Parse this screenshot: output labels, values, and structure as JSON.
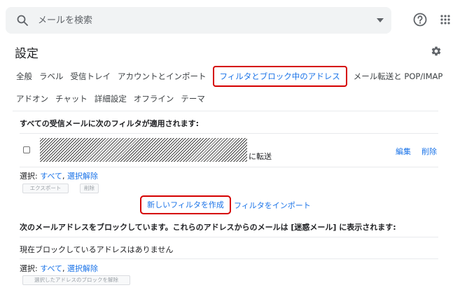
{
  "search": {
    "placeholder": "メールを検索"
  },
  "header": {
    "title": "設定"
  },
  "tabs_row1": [
    {
      "label": "全般"
    },
    {
      "label": "ラベル"
    },
    {
      "label": "受信トレイ"
    },
    {
      "label": "アカウントとインポート"
    },
    {
      "label": "フィルタとブロック中のアドレス",
      "active": true
    },
    {
      "label": "メール転送と POP/IMAP"
    }
  ],
  "tabs_row2": [
    {
      "label": "アドオン"
    },
    {
      "label": "チャット"
    },
    {
      "label": "詳細設定"
    },
    {
      "label": "オフライン"
    },
    {
      "label": "テーマ"
    }
  ],
  "filters": {
    "heading": "すべての受信メールに次のフィルタが適用されます:",
    "row": {
      "action": "に転送",
      "edit": "編集",
      "delete": "削除"
    },
    "select_label": "選択:",
    "select_all": "すべて",
    "select_none": "選択解除",
    "export": "エクスポート",
    "delete": "削除",
    "create": "新しいフィルタを作成",
    "import": "フィルタをインポート"
  },
  "blocked": {
    "heading": "次のメールアドレスをブロックしています。これらのアドレスからのメールは [迷惑メール] に表示されます:",
    "empty": "現在ブロックしているアドレスはありません",
    "select_label": "選択:",
    "select_all": "すべて",
    "select_none": "選択解除",
    "unblock": "選択したアドレスのブロックを解除"
  },
  "colors": {
    "accent": "#1a73e8",
    "highlight": "#d50000"
  }
}
